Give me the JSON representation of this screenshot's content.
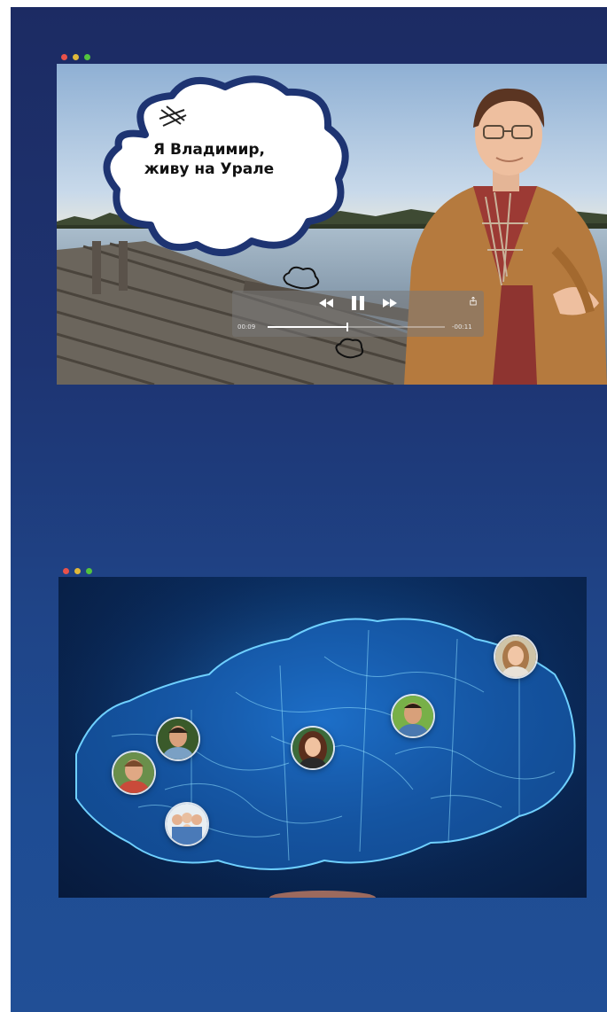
{
  "video": {
    "bubble_line1": "Я Владимир,",
    "bubble_line2": "живу на Урале",
    "player": {
      "elapsed": "00:09",
      "remaining": "-00:11",
      "progress_fraction": 0.45,
      "rewind_icon": "rewind-icon",
      "pause_icon": "pause-icon",
      "forward_icon": "fast-forward-icon",
      "share_icon": "share-icon"
    }
  },
  "window_dots": {
    "close_color": "#e9524a",
    "minimize_color": "#e0b83a",
    "zoom_color": "#53c43e"
  },
  "map": {
    "avatars": [
      "avatar-man-1",
      "avatar-man-2",
      "avatar-family",
      "avatar-woman-1",
      "avatar-man-3",
      "avatar-woman-2"
    ]
  }
}
